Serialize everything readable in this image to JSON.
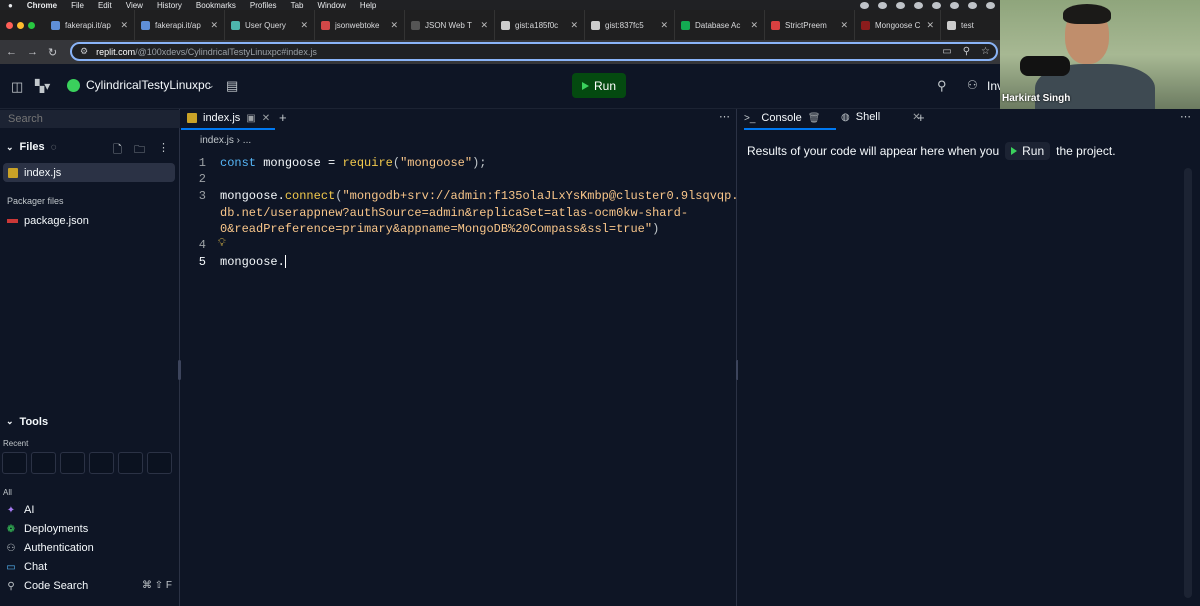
{
  "menubar": {
    "app": "Chrome",
    "items": [
      "File",
      "Edit",
      "View",
      "History",
      "Bookmarks",
      "Profiles",
      "Tab",
      "Window",
      "Help"
    ]
  },
  "browser_tabs": [
    {
      "title": "fakerapi.it/ap",
      "color": "#5f8fd8"
    },
    {
      "title": "fakerapi.it/ap",
      "color": "#5f8fd8"
    },
    {
      "title": "User Query",
      "color": "#4db6ac"
    },
    {
      "title": "jsonwebtoke",
      "color": "#d34848"
    },
    {
      "title": "JSON Web T",
      "color": "#222222"
    },
    {
      "title": "gist:a185f0c",
      "color": "#cccccc"
    },
    {
      "title": "gist:837fc5",
      "color": "#cccccc"
    },
    {
      "title": "Database Ac",
      "color": "#13aa52"
    },
    {
      "title": "StrictPreem",
      "color": "#d84040"
    },
    {
      "title": "Mongoose C",
      "color": "#8a1c1c"
    },
    {
      "title": "test",
      "color": "#cccccc"
    }
  ],
  "address_bar": {
    "host": "replit.com",
    "path": "/@100xdevs/CylindricalTestyLinuxpc#index.js"
  },
  "replit": {
    "repl_name": "CylindricalTestyLinuxpc",
    "run_label": "Run",
    "invite_label": "Inv"
  },
  "webcam": {
    "name": "Harkirat Singh"
  },
  "sidebar": {
    "search_placeholder": "Search",
    "files_label": "Files",
    "active_file": "index.js",
    "packager_label": "Packager files",
    "package_file": "package.json",
    "tools_label": "Tools",
    "recent_label": "Recent",
    "all_label": "All",
    "tools": [
      {
        "label": "AI",
        "icon": "ai-icon"
      },
      {
        "label": "Deployments",
        "icon": "deployments-icon"
      },
      {
        "label": "Authentication",
        "icon": "authentication-icon"
      },
      {
        "label": "Chat",
        "icon": "chat-icon"
      },
      {
        "label": "Code Search",
        "icon": "code-search-icon"
      }
    ],
    "shortcut": "⌘ ⇧ F"
  },
  "editor": {
    "tab_label": "index.js",
    "breadcrumb": "index.js  ›  ...",
    "lines": {
      "l1": {
        "kw": "const",
        "id": " mongoose = ",
        "fn": "require",
        "pre": "(",
        "str": "\"mongoose\"",
        "post": ");"
      },
      "l3a": {
        "pre": "mongoose.",
        "fn": "connect",
        "p": "(",
        "str": "\"mongodb+srv://admin:f135olaJLxYsKmbp@cluster0.9lsqvqp.mongo"
      },
      "l3b": "db.net/userappnew?authSource=admin&replicaSet=atlas-ocm0kw-shard-",
      "l3c": {
        "str": "0&readPreference=primary&appname=MongoDB%20Compass&ssl=true\"",
        "post": ")"
      },
      "l5": "mongoose."
    },
    "line_numbers": [
      "1",
      "2",
      "3",
      "4",
      "5"
    ]
  },
  "console": {
    "tab_label": "Console",
    "shell_label": "Shell",
    "message_before": "Results of your code will appear here when you",
    "run_label": "Run",
    "message_after": "the project."
  }
}
